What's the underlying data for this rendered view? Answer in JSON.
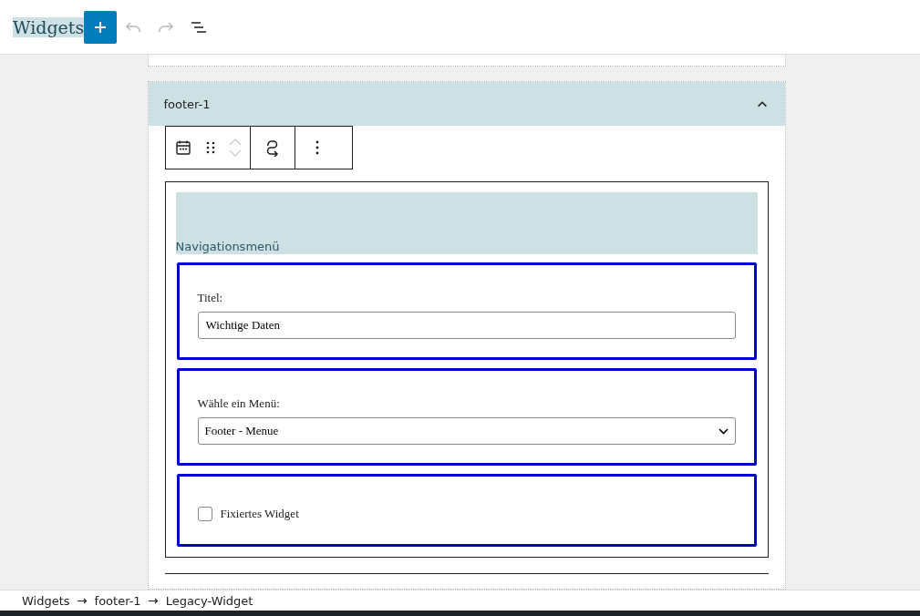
{
  "header": {
    "title": "Widgets",
    "undo": {
      "disabled": true
    },
    "redo": {
      "disabled": true
    }
  },
  "area": {
    "title": "footer-1",
    "expanded": true
  },
  "widget": {
    "title": "Navigationsmenü",
    "fields": [
      {
        "kind": "text",
        "label": "Titel:",
        "value": "Wichtige Daten"
      },
      {
        "kind": "select",
        "label": "Wähle ein Menü:",
        "value": "Footer - Menue"
      },
      {
        "kind": "checkbox",
        "label": "Fixiertes Widget",
        "checked": false
      }
    ]
  },
  "breadcrumbs": [
    "Widgets",
    "footer-1",
    "Legacy-Widget"
  ]
}
